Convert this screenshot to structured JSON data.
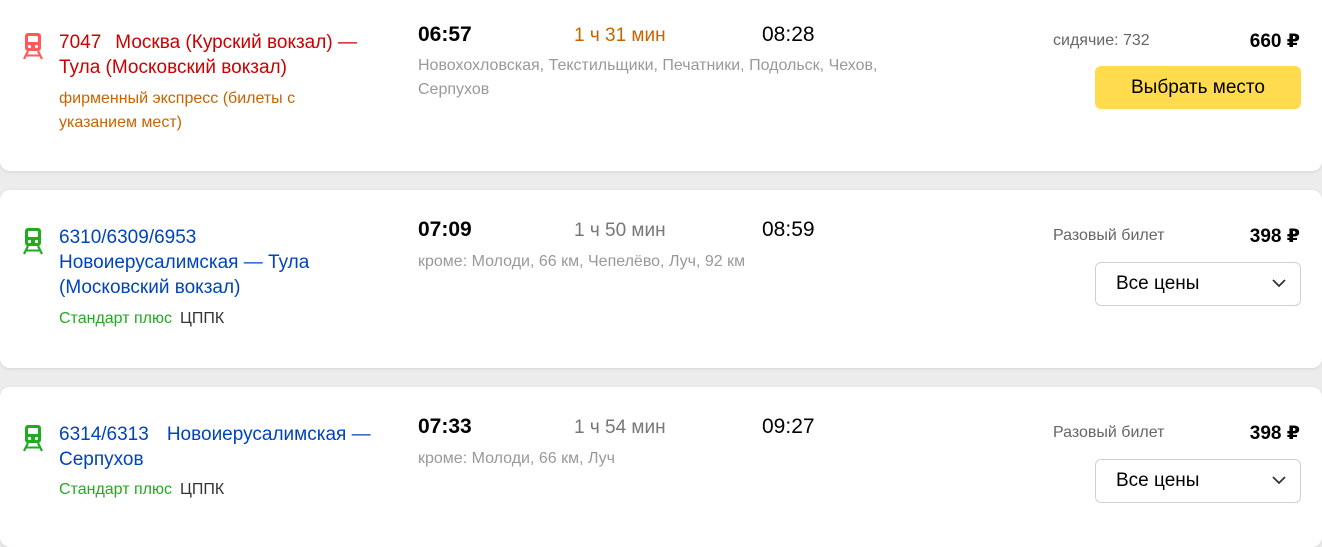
{
  "colors": {
    "express": "#cc0000",
    "express_note": "#c86400",
    "suburban": "#0044bb",
    "standard_plus": "#22aa22",
    "duration_highlight": "#c86400",
    "duration_normal": "#777777",
    "button": "#ffdb4d"
  },
  "trains": [
    {
      "icon": "train-icon",
      "number": "7047",
      "route_line1": "Москва (Курский вокзал) —",
      "route_line2": "Тула (Московский вокзал)",
      "note": "фирменный экспресс (билеты с указанием мест)",
      "departure": "06:57",
      "duration": "1 ч 31 мин",
      "arrival": "08:28",
      "stops": "Новохохловская, Текстильщики, Печатники, Подольск, Чехов, Серпухов",
      "ticket_label": "сидячие: 732",
      "price": "660 ₽",
      "action": "Выбрать место"
    },
    {
      "icon": "train-icon",
      "number": "6310/6309/6953",
      "route": "Новоиерусалимская — Тула (Московский вокзал)",
      "category": "Стандарт плюс",
      "carrier": "ЦППК",
      "departure": "07:09",
      "duration": "1 ч 50 мин",
      "arrival": "08:59",
      "stops": "кроме: Молоди, 66 км, Чепелёво, Луч, 92 км",
      "ticket_label": "Разовый билет",
      "price": "398 ₽",
      "select_value": "Все цены"
    },
    {
      "icon": "train-icon",
      "number": "6314/6313",
      "route_line1": "Новоиерусалимская —",
      "route_line2": "Серпухов",
      "category": "Стандарт плюс",
      "carrier": "ЦППК",
      "departure": "07:33",
      "duration": "1 ч 54 мин",
      "arrival": "09:27",
      "stops": "кроме: Молоди, 66 км, Луч",
      "ticket_label": "Разовый билет",
      "price": "398 ₽",
      "select_value": "Все цены"
    }
  ]
}
